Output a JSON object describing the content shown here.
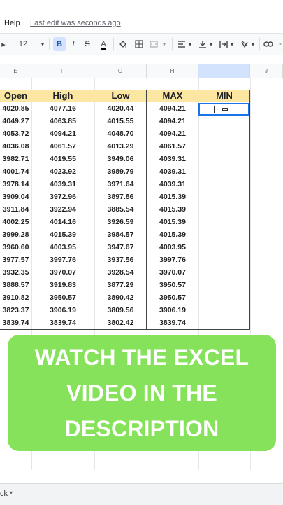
{
  "menu": {
    "help": "Help",
    "last_edit": "Last edit was seconds ago"
  },
  "toolbar": {
    "font_size": "12",
    "bold": "B",
    "italic": "I",
    "strike": "S",
    "text_color": "A",
    "minus": "-",
    "icons": [
      "dropdown-arrow-icon",
      "bold-icon",
      "italic-icon",
      "strikethrough-icon",
      "text-color-icon",
      "fill-color-icon",
      "borders-icon",
      "merge-cells-icon",
      "horizontal-align-icon",
      "vertical-align-icon",
      "text-wrap-icon",
      "text-rotation-icon",
      "link-icon"
    ]
  },
  "columns": [
    "E",
    "F",
    "G",
    "H",
    "I",
    "J"
  ],
  "table": {
    "headers": [
      "Open",
      "High",
      "Low",
      "MAX",
      "MIN"
    ],
    "rows": [
      [
        "4020.85",
        "4077.16",
        "4020.44",
        "4094.21",
        ""
      ],
      [
        "4049.27",
        "4063.85",
        "4015.55",
        "4094.21",
        ""
      ],
      [
        "4053.72",
        "4094.21",
        "4048.70",
        "4094.21",
        ""
      ],
      [
        "4036.08",
        "4061.57",
        "4013.29",
        "4061.57",
        ""
      ],
      [
        "3982.71",
        "4019.55",
        "3949.06",
        "4039.31",
        ""
      ],
      [
        "4001.74",
        "4023.92",
        "3989.79",
        "4039.31",
        ""
      ],
      [
        "3978.14",
        "4039.31",
        "3971.64",
        "4039.31",
        ""
      ],
      [
        "3909.04",
        "3972.96",
        "3897.86",
        "4015.39",
        ""
      ],
      [
        "3911.84",
        "3922.94",
        "3885.54",
        "4015.39",
        ""
      ],
      [
        "4002.25",
        "4014.16",
        "3926.59",
        "4015.39",
        ""
      ],
      [
        "3999.28",
        "4015.39",
        "3984.57",
        "4015.39",
        ""
      ],
      [
        "3960.60",
        "4003.95",
        "3947.67",
        "4003.95",
        ""
      ],
      [
        "3977.57",
        "3997.76",
        "3937.56",
        "3997.76",
        ""
      ],
      [
        "3932.35",
        "3970.07",
        "3928.54",
        "3970.07",
        ""
      ],
      [
        "3888.57",
        "3919.83",
        "3877.29",
        "3950.57",
        ""
      ],
      [
        "3910.82",
        "3950.57",
        "3890.42",
        "3950.57",
        ""
      ],
      [
        "3823.37",
        "3906.19",
        "3809.56",
        "3906.19",
        ""
      ],
      [
        "3839.74",
        "3839.74",
        "3802.42",
        "3839.74",
        ""
      ]
    ]
  },
  "banner": {
    "text": "WATCH THE EXCEL VIDEO IN THE DESCRIPTION",
    "color": "#86e25a"
  },
  "bottom": {
    "sheet_tab": "ck"
  }
}
